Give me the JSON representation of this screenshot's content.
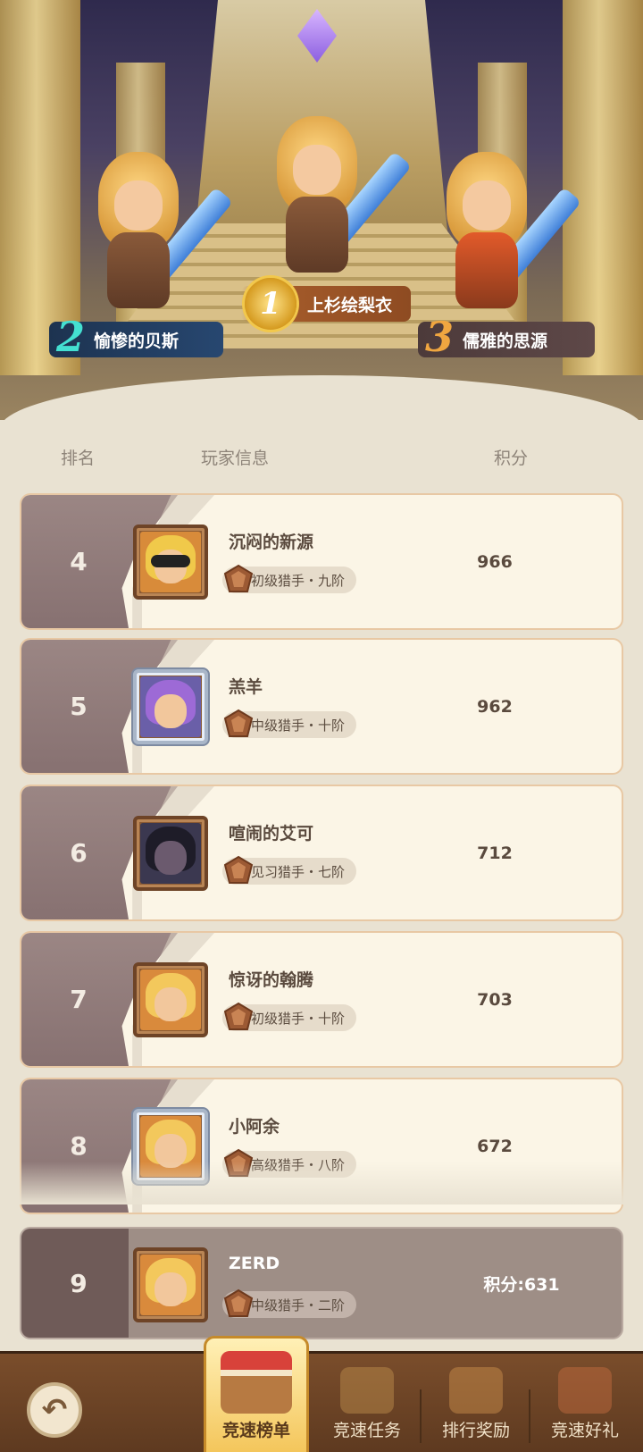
{
  "podium": {
    "first": {
      "rank": "1",
      "name": "上杉绘梨衣"
    },
    "second": {
      "rank": "2",
      "name": "愉惨的贝斯"
    },
    "third": {
      "rank": "3",
      "name": "儒雅的思源"
    }
  },
  "columns": {
    "rank": "排名",
    "player": "玩家信息",
    "score": "积分"
  },
  "rows": [
    {
      "rank": "4",
      "name": "沉闷的新源",
      "title": "初级猎手・九阶",
      "score": "966"
    },
    {
      "rank": "5",
      "name": "羔羊",
      "title": "中级猎手・十阶",
      "score": "962"
    },
    {
      "rank": "6",
      "name": "喧闹的艾可",
      "title": "见习猎手・七阶",
      "score": "712"
    },
    {
      "rank": "7",
      "name": "惊讶的翰腾",
      "title": "初级猎手・十阶",
      "score": "703"
    },
    {
      "rank": "8",
      "name": "小阿余",
      "title": "高级猎手・八阶",
      "score": "672"
    }
  ],
  "self": {
    "rank": "9",
    "name": "ZERD",
    "title": "中级猎手・二阶",
    "score": "积分:631"
  },
  "nav": {
    "back_icon": "back-arrow-icon",
    "tabs": [
      {
        "label": "竞速榜单",
        "icon": "shop-stall-icon",
        "active": true
      },
      {
        "label": "竞速任务",
        "icon": "task-chest-icon",
        "active": false
      },
      {
        "label": "排行奖励",
        "icon": "gift-box-icon",
        "active": false
      },
      {
        "label": "竞速好礼",
        "icon": "treasure-icon",
        "active": false
      }
    ]
  },
  "colors": {
    "accent": "#f4c65b",
    "rank_bg": "#877171",
    "card_bg": "#fbf5e6"
  }
}
